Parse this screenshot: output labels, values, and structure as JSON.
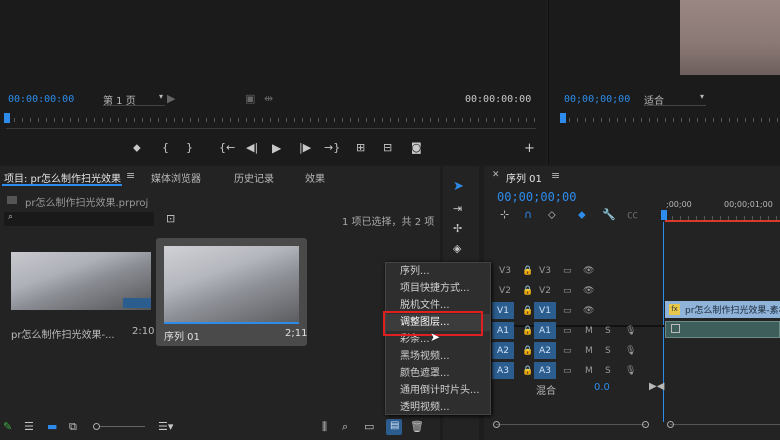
{
  "source_monitor": {
    "timecode_left": "00:00:00:00",
    "page_select": "第 1 页",
    "timecode_right": "00:00:00:00"
  },
  "program_monitor": {
    "timecode": "00;00;00;00",
    "fit_select": "适合"
  },
  "project_panel": {
    "tabs": [
      "项目: pr怎么制作扫光效果",
      "媒体浏览器",
      "历史记录",
      "效果"
    ],
    "project_file": "pr怎么制作扫光效果.prproj",
    "selection_status": "1 项已选择，共 2 项",
    "items": [
      {
        "name": "pr怎么制作扫光效果-...",
        "duration": "2:10"
      },
      {
        "name": "序列 01",
        "duration": "2;11"
      }
    ]
  },
  "context_menu": {
    "items": [
      "序列...",
      "项目快捷方式...",
      "脱机文件...",
      "调整图层...",
      "彩条...",
      "黑场视频...",
      "颜色遮罩...",
      "通用倒计时片头...",
      "透明视频..."
    ],
    "highlighted_index": 3
  },
  "timeline": {
    "tab": "序列 01",
    "timecode": "00;00;00;00",
    "ruler_labels": [
      ";00;00",
      "00;00;01;00"
    ],
    "tracks": [
      {
        "left": "V3",
        "right": "V3"
      },
      {
        "left": "V2",
        "right": "V2"
      },
      {
        "left": "V1",
        "right": "V1"
      },
      {
        "left": "A1",
        "right": "A1"
      },
      {
        "left": "A2",
        "right": "A2"
      },
      {
        "left": "A3",
        "right": "A3"
      }
    ],
    "mix_label": "混合",
    "mix_value": "0.0",
    "clip_label": "pr怎么制作扫光效果-素材"
  },
  "audio_btns": {
    "m": "M",
    "s": "S"
  },
  "fx_badge": "fx",
  "colors": {
    "accent": "#2d8ceb",
    "highlight_box": "#e02020",
    "track_blue": "#2c5d8f"
  }
}
